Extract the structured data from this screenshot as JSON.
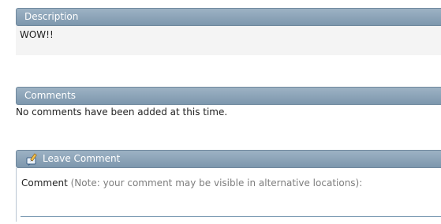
{
  "description": {
    "title": "Description",
    "text": "WOW!!"
  },
  "comments": {
    "title": "Comments",
    "empty_message": "No comments have been added at this time."
  },
  "leave_comment": {
    "title": "Leave Comment",
    "icon": "comment-pen-icon",
    "field_label": "Comment",
    "field_note": "(Note: your comment may be visible in alternative locations):",
    "field_value": ""
  }
}
